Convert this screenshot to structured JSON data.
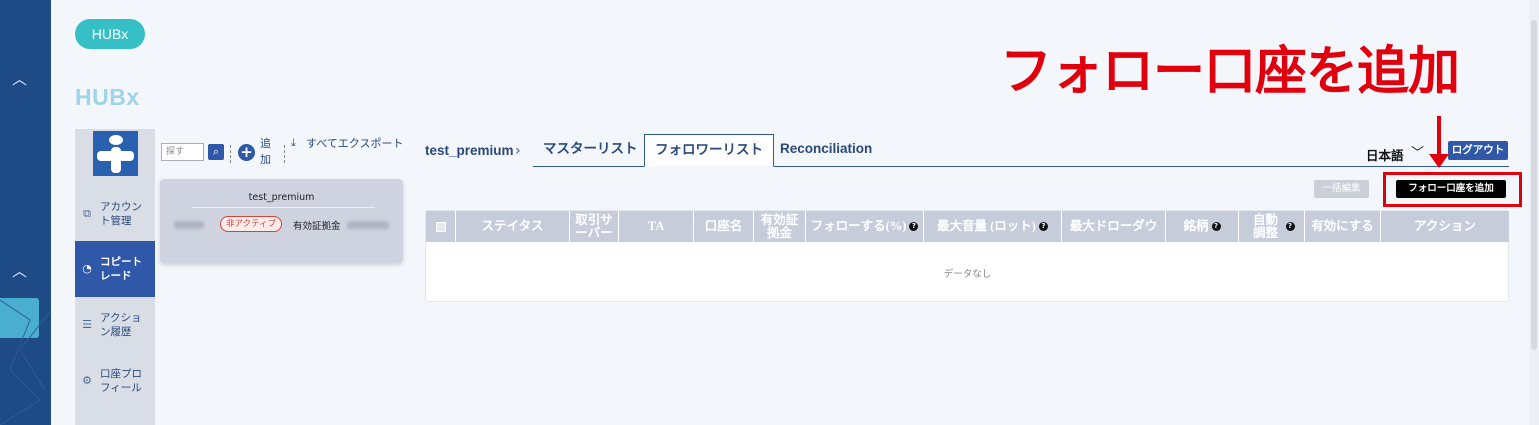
{
  "app": {
    "pill_label": "HUBx",
    "brand": "HUBx"
  },
  "nav": {
    "items": [
      {
        "label": "アカウント管理",
        "icon": "copy-icon"
      },
      {
        "label": "コピートレード",
        "icon": "pie-chart-icon",
        "active": true
      },
      {
        "label": "アクション履歴",
        "icon": "list-icon"
      },
      {
        "label": "口座プロフィール",
        "icon": "gear-icon"
      }
    ]
  },
  "accounts": {
    "search_placeholder": "探す",
    "add_label": "追加",
    "export_label": "すべてエクスポート",
    "card": {
      "name": "test_premium",
      "status": "非アクティブ",
      "margin_label": "有効証拠金"
    }
  },
  "main": {
    "breadcrumb": "test_premium",
    "tabs": [
      {
        "label": "マスターリスト",
        "active": false
      },
      {
        "label": "フォロワーリスト",
        "active": true
      },
      {
        "label": "Reconciliation",
        "active": false
      }
    ],
    "language": "日本語",
    "logout_label": "ログアウト",
    "bulk_edit_label": "一括編集",
    "add_follow_label": "フォロー口座を追加",
    "annotation": "フォロー口座を追加",
    "table": {
      "columns": [
        "ステイタス",
        "取引サーバー",
        "TA",
        "口座名",
        "有効証拠金",
        "フォローする(%)",
        "最大音量 (ロット)",
        "最大ドローダウ",
        "銘柄",
        "自動調整",
        "有効にする",
        "アクション"
      ],
      "empty_text": "データなし"
    }
  },
  "colors": {
    "accent": "#2f58a8",
    "rail": "#1e4b86",
    "annotation_red": "#e0000d",
    "teal": "#36c0c5"
  }
}
